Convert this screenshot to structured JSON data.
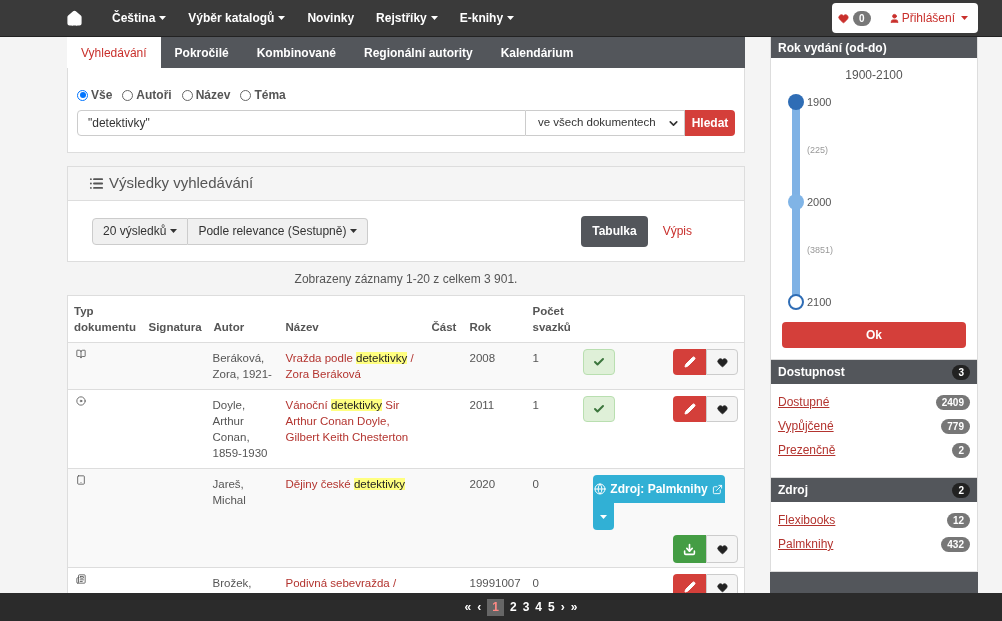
{
  "navbar": {
    "items": [
      {
        "label": "Čeština",
        "dropdown": true
      },
      {
        "label": "Výběr katalogů",
        "dropdown": true
      },
      {
        "label": "Novinky",
        "dropdown": false
      },
      {
        "label": "Rejstříky",
        "dropdown": true
      },
      {
        "label": "E-knihy",
        "dropdown": true
      }
    ],
    "favorites_count": "0",
    "login": "Přihlášení"
  },
  "search": {
    "tabs": [
      {
        "label": "Vyhledávání",
        "selected": true
      },
      {
        "label": "Pokročilé",
        "selected": false
      },
      {
        "label": "Kombinované",
        "selected": false
      },
      {
        "label": "Regionální autority",
        "selected": false
      },
      {
        "label": "Kalendárium",
        "selected": false
      }
    ],
    "scopes": [
      {
        "label": "Vše",
        "selected": true
      },
      {
        "label": "Autoři",
        "selected": false
      },
      {
        "label": "Název",
        "selected": false
      },
      {
        "label": "Téma",
        "selected": false
      }
    ],
    "query": "\"detektivky\"",
    "in": "ve všech dokumentech",
    "button": "Hledat"
  },
  "results": {
    "title": "Výsledky vyhledávání",
    "page_size": "20 výsledků",
    "sort": "Podle relevance (Sestupně)",
    "views": [
      {
        "label": "Tabulka",
        "selected": true
      },
      {
        "label": "Výpis",
        "selected": false
      }
    ],
    "summary": "Zobrazeny záznamy 1-20 z celkem 3 901."
  },
  "table": {
    "columns": [
      "Typ dokumentu",
      "Signatura",
      "Autor",
      "Název",
      "Část",
      "Rok",
      "Počet svazků"
    ],
    "rows": [
      {
        "kind": "book",
        "author": "Beráková, Zora, 1921-",
        "title": [
          {
            "text": "Vražda podle ",
            "highlight": false
          },
          {
            "text": "detektivky",
            "highlight": true
          },
          {
            "text": " / Zora Beráková",
            "highlight": false
          }
        ],
        "year": "2008",
        "volumes": "1",
        "actions": [
          {
            "kind": "available"
          },
          {
            "kind": "edit"
          },
          {
            "kind": "favorite"
          }
        ]
      },
      {
        "kind": "disc",
        "author": "Doyle, Arthur Conan, 1859-1930",
        "title": [
          {
            "text": "Vánoční ",
            "highlight": false
          },
          {
            "text": "detektivky",
            "highlight": true
          },
          {
            "text": " Sir Arthur Conan Doyle, Gilbert Keith Chesterton",
            "highlight": false
          }
        ],
        "year": "2011",
        "volumes": "1",
        "actions": [
          {
            "kind": "available"
          },
          {
            "kind": "edit"
          },
          {
            "kind": "favorite"
          }
        ]
      },
      {
        "kind": "tablet",
        "author": "Jareš, Michal",
        "title": [
          {
            "text": "Dějiny české ",
            "highlight": false
          },
          {
            "text": "detektivky",
            "highlight": true
          }
        ],
        "year": "2020",
        "volumes": "0",
        "actions": [
          {
            "kind": "source",
            "label": "Zdroj: Palmknihy"
          },
          {
            "kind": "source-menu"
          },
          {
            "kind": "download"
          },
          {
            "kind": "favorite"
          }
        ]
      },
      {
        "kind": "newspaper",
        "author": "Brožek,",
        "title": [
          {
            "text": "Podivná sebevražda /",
            "highlight": false
          }
        ],
        "year": "19991007",
        "volumes": "0",
        "actions": [
          {
            "kind": "edit"
          },
          {
            "kind": "favorite"
          }
        ]
      }
    ]
  },
  "pagination": {
    "first": "«",
    "prev": "‹",
    "pages": [
      {
        "label": "1",
        "selected": true
      },
      {
        "label": "2",
        "selected": false
      },
      {
        "label": "3",
        "selected": false
      },
      {
        "label": "4",
        "selected": false
      },
      {
        "label": "5",
        "selected": false
      }
    ],
    "next": "›",
    "last": "»"
  },
  "sidebar": {
    "year_filter": {
      "title": "Rok vydání (od-do)",
      "range": "1900-2100",
      "ticks": [
        {
          "label": "1900",
          "kind": "handle-low"
        },
        {
          "label": "(225)",
          "kind": "count"
        },
        {
          "label": "2000",
          "kind": "midpoint"
        },
        {
          "label": "(3851)",
          "kind": "count"
        },
        {
          "label": "2100",
          "kind": "handle-high"
        }
      ],
      "button": "Ok"
    },
    "facets": [
      {
        "title": "Dostupnost",
        "count": "3",
        "items": [
          {
            "label": "Dostupné",
            "count": "2409"
          },
          {
            "label": "Vypůjčené",
            "count": "779"
          },
          {
            "label": "Prezenčně",
            "count": "2"
          }
        ]
      },
      {
        "title": "Zdroj",
        "count": "2",
        "items": [
          {
            "label": "Flexibooks",
            "count": "12"
          },
          {
            "label": "Palmknihy",
            "count": "432"
          }
        ]
      }
    ]
  }
}
